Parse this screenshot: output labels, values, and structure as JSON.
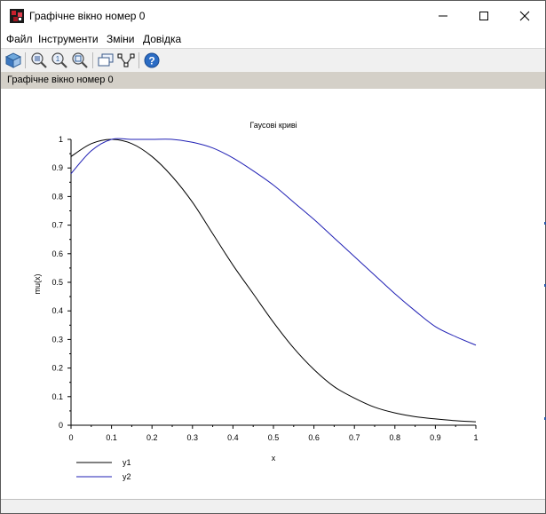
{
  "window": {
    "title": "Графічне вікно номер 0"
  },
  "menu": [
    "Файл",
    "Інструменти",
    "Зміни",
    "Довідка"
  ],
  "toolbar": {
    "icons": [
      "rotate-icon",
      "zoom-in-icon",
      "zoom-original-icon",
      "zoom-area-icon",
      "datatip-icon",
      "data-editor-icon",
      "help-icon"
    ]
  },
  "infobar": {
    "text": "Графічне вікно номер 0"
  },
  "chart_data": {
    "type": "line",
    "title": "Гаусові криві",
    "xlabel": "x",
    "ylabel": "mu(x)",
    "xlim": [
      0,
      1
    ],
    "ylim": [
      0,
      1
    ],
    "xticks": [
      "0",
      "0.1",
      "0.2",
      "0.3",
      "0.4",
      "0.5",
      "0.6",
      "0.7",
      "0.8",
      "0.9",
      "1"
    ],
    "yticks": [
      "0",
      "0.1",
      "0.2",
      "0.3",
      "0.4",
      "0.5",
      "0.6",
      "0.7",
      "0.8",
      "0.9",
      "1"
    ],
    "legend_position": "bottom-left",
    "series": [
      {
        "name": "y1",
        "color": "#000000",
        "x": [
          0,
          0.05,
          0.1,
          0.15,
          0.2,
          0.25,
          0.3,
          0.35,
          0.4,
          0.45,
          0.5,
          0.55,
          0.6,
          0.65,
          0.7,
          0.75,
          0.8,
          0.85,
          0.9,
          0.95,
          1
        ],
        "y": [
          0.94,
          0.985,
          1.0,
          0.985,
          0.94,
          0.87,
          0.78,
          0.67,
          0.56,
          0.46,
          0.36,
          0.27,
          0.195,
          0.135,
          0.095,
          0.063,
          0.043,
          0.03,
          0.022,
          0.016,
          0.012
        ]
      },
      {
        "name": "y2",
        "color": "#1f1fb4",
        "x": [
          0,
          0.05,
          0.1,
          0.15,
          0.2,
          0.25,
          0.3,
          0.35,
          0.4,
          0.45,
          0.5,
          0.55,
          0.6,
          0.65,
          0.7,
          0.75,
          0.8,
          0.85,
          0.9,
          0.95,
          1
        ],
        "y": [
          0.88,
          0.96,
          1.0,
          1.0,
          1.0,
          1.0,
          0.99,
          0.97,
          0.935,
          0.89,
          0.84,
          0.78,
          0.72,
          0.655,
          0.59,
          0.525,
          0.46,
          0.4,
          0.345,
          0.31,
          0.28
        ]
      }
    ]
  }
}
